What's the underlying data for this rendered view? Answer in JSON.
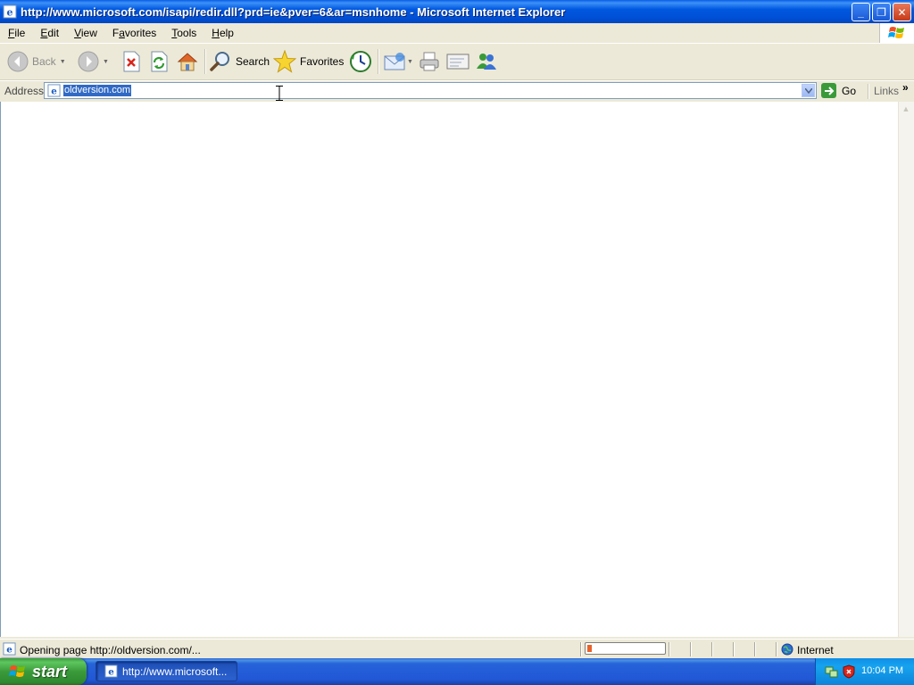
{
  "window": {
    "title": "http://www.microsoft.com/isapi/redir.dll?prd=ie&pver=6&ar=msnhome - Microsoft Internet Explorer",
    "min_glyph": "_",
    "max_glyph": "❐",
    "close_glyph": "✕"
  },
  "menu": {
    "items": [
      {
        "mnemonic": "F",
        "rest": "ile"
      },
      {
        "mnemonic": "E",
        "rest": "dit"
      },
      {
        "mnemonic": "V",
        "rest": "iew"
      },
      {
        "mnemonic": "",
        "rest": "Favorites",
        "underline_index": 1
      },
      {
        "mnemonic": "T",
        "rest": "ools"
      },
      {
        "mnemonic": "H",
        "rest": "elp"
      }
    ]
  },
  "toolbar": {
    "back_label": "Back",
    "search_label": "Search",
    "favorites_label": "Favorites"
  },
  "address": {
    "label": "Address",
    "value": "oldversion.com",
    "go_label": "Go",
    "links_label": "Links",
    "links_chevron": "»"
  },
  "status": {
    "text": "Opening page http://oldversion.com/...",
    "progress_fraction": 0.06,
    "zone": "Internet"
  },
  "taskbar": {
    "start_label": "start",
    "task_label": "http://www.microsoft...",
    "clock": "10:04 PM"
  },
  "colors": {
    "titlebar": "#0058e0",
    "selection": "#316ac5",
    "progress": "#e8632a",
    "start_green": "#3a9a3a",
    "taskbar_blue": "#2157d6"
  },
  "icons": [
    "ie-page-icon",
    "back-icon",
    "forward-icon",
    "stop-icon",
    "refresh-icon",
    "home-icon",
    "search-icon",
    "favorites-icon",
    "history-icon",
    "mail-icon",
    "print-icon",
    "edit-icon",
    "messenger-icon",
    "go-arrow-icon",
    "windows-flag-icon",
    "globe-icon",
    "security-shield-icon"
  ]
}
